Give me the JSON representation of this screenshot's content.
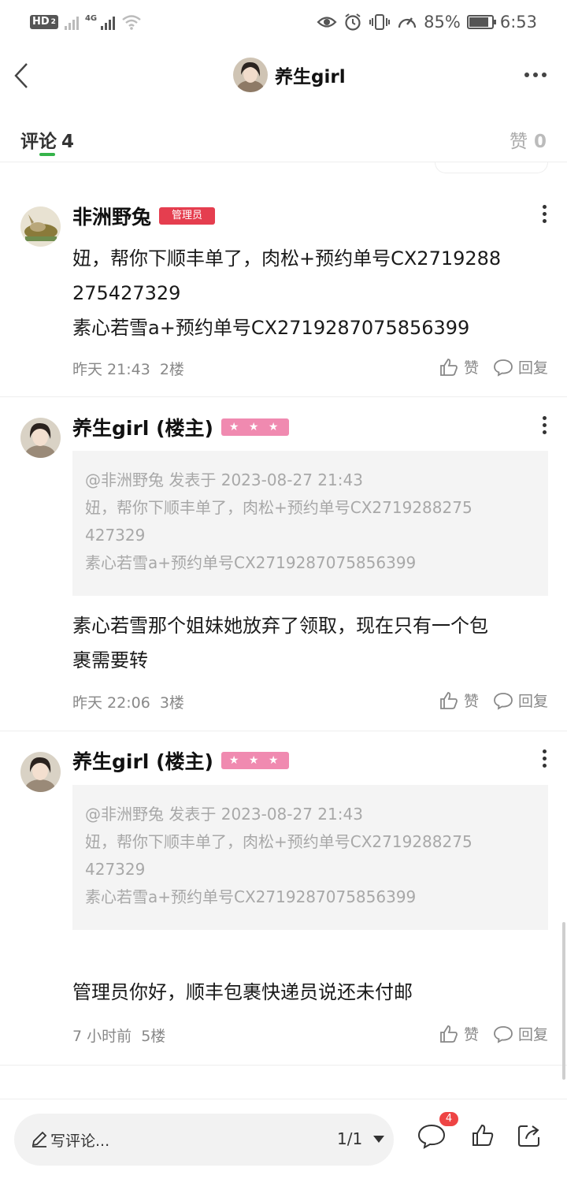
{
  "status_bar": {
    "hd_label": "HD",
    "sim_slot": "2",
    "network_type": "4G",
    "battery_percent": "85%",
    "battery_level": 0.85,
    "time": "6:53",
    "icons": [
      "hd-icon",
      "no-signal-icon",
      "signal-icon",
      "wifi-icon",
      "eye-icon",
      "alarm-icon",
      "vibrate-icon",
      "speed-icon",
      "battery-icon"
    ]
  },
  "header": {
    "title": "养生girl"
  },
  "tabs": {
    "comments_label": "评论",
    "comments_count": "4",
    "likes_label": "赞",
    "likes_count": "0"
  },
  "comments": [
    {
      "author": "非洲野兔",
      "badge": "管理员",
      "text_line1": "妞，帮你下顺丰单了，肉松+预约单号CX2719288",
      "text_line2": "275427329",
      "text_line3": "素心若雪a+预约单号CX2719287075856399",
      "time": "昨天 21:43",
      "floor": "2楼",
      "like_label": "赞",
      "reply_label": "回复"
    },
    {
      "author": "养生girl (楼主)",
      "badge": "★ ★ ★",
      "quote_meta": "@非洲野兔 发表于 2023-08-27 21:43",
      "quote_line1": "妞，帮你下顺丰单了，肉松+预约单号CX2719288275",
      "quote_line2": "427329",
      "quote_line3": "素心若雪a+预约单号CX2719287075856399",
      "text_line1": "素心若雪那个姐妹她放弃了领取，现在只有一个包",
      "text_line2": "裹需要转",
      "time": "昨天 22:06",
      "floor": "3楼",
      "like_label": "赞",
      "reply_label": "回复"
    },
    {
      "author": "养生girl (楼主)",
      "badge": "★ ★ ★",
      "quote_meta": "@非洲野兔 发表于 2023-08-27 21:43",
      "quote_line1": "妞，帮你下顺丰单了，肉松+预约单号CX2719288275",
      "quote_line2": "427329",
      "quote_line3": "素心若雪a+预约单号CX2719287075856399",
      "text_line1": "管理员你好，顺丰包裹快递员说还未付邮",
      "time": "7 小时前",
      "floor": "5楼",
      "like_label": "赞",
      "reply_label": "回复"
    }
  ],
  "bottom_bar": {
    "input_placeholder": "写评论...",
    "page_indicator": "1/1",
    "comment_badge": "4"
  },
  "colors": {
    "accent_green": "#35b34a",
    "admin_badge": "#e53e4f",
    "star_badge": "#f08ab0",
    "notification_badge": "#ee4444"
  }
}
